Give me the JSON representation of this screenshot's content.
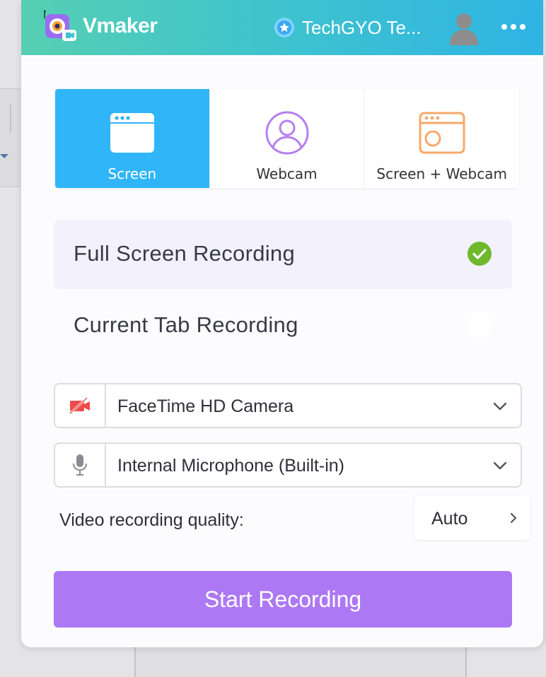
{
  "header": {
    "brand": "Vmaker",
    "team_name": "TechGYO Te...",
    "colors": {
      "gradient_start": "#56cfb2",
      "gradient_end": "#2fb4e4"
    }
  },
  "modes": [
    {
      "label": "Screen",
      "icon": "screen-window-icon",
      "active": true
    },
    {
      "label": "Webcam",
      "icon": "webcam-user-icon",
      "active": false
    },
    {
      "label": "Screen + Webcam",
      "icon": "screen-webcam-icon",
      "active": false
    }
  ],
  "options": [
    {
      "label": "Full Screen Recording",
      "selected": true
    },
    {
      "label": "Current Tab Recording",
      "selected": false
    }
  ],
  "camera": {
    "value": "FaceTime HD Camera",
    "icon": "camera-off-icon"
  },
  "microphone": {
    "value": "Internal Microphone (Built-in)",
    "icon": "microphone-icon"
  },
  "quality": {
    "label": "Video recording quality:",
    "value": "Auto"
  },
  "start_button": {
    "label": "Start Recording",
    "color": "#ad78f4"
  },
  "accent": "#30b5f8",
  "success": "#6fb82d"
}
